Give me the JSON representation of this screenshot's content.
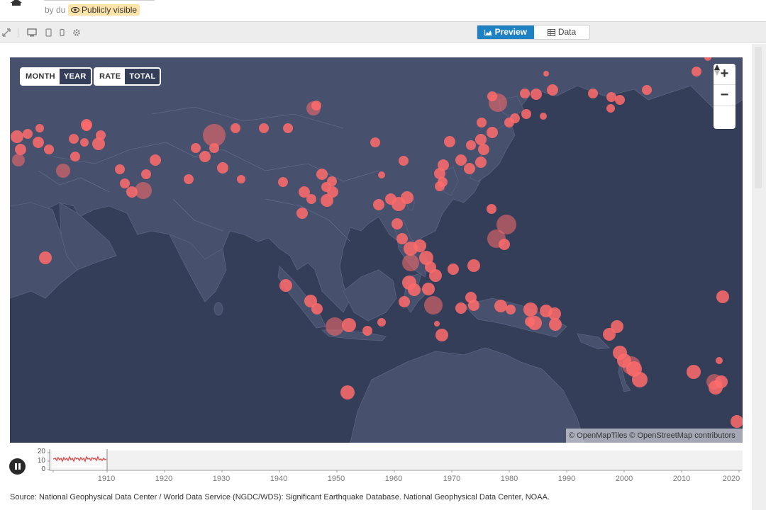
{
  "header": {
    "byline": "by du",
    "visibility": "Publicly visible"
  },
  "toolbar": {
    "tabs": [
      {
        "label": "Preview",
        "active": true
      },
      {
        "label": "Data",
        "active": false
      }
    ]
  },
  "map": {
    "period_toggle": {
      "options": [
        "MONTH",
        "YEAR"
      ],
      "selected": "YEAR"
    },
    "measure_toggle": {
      "options": [
        "RATE",
        "TOTAL"
      ],
      "selected": "TOTAL"
    },
    "zoom_in": "+",
    "zoom_out": "−",
    "reset_north": "▲",
    "attribution": "© OpenMapTiles © OpenStreetMap contributors",
    "land_color": "#47506c",
    "water_color": "#343e59",
    "marker_color": "#ff6b6b"
  },
  "timeline": {
    "y_ticks": [
      "20",
      "10",
      "0"
    ],
    "x_ticks": [
      "1910",
      "1920",
      "1930",
      "1940",
      "1950",
      "1960",
      "1970",
      "1980",
      "1990",
      "2000",
      "2010",
      "2020"
    ]
  },
  "source": "Source: National Geophysical Data Center / World Data Service (NGDC/WDS): Significant Earthquake Database. National Geophysical Data Center, NOAA."
}
